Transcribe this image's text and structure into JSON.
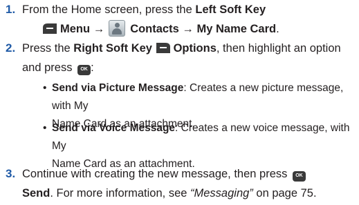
{
  "steps": [
    {
      "num": "1.",
      "line1": "From the Home screen, press the ",
      "line1_b": "Left Soft Key",
      "menu": "Menu",
      "arrow": "→",
      "contacts": "Contacts",
      "my_name_card": "My Name Card",
      "period": "."
    },
    {
      "num": "2.",
      "press": "Press the ",
      "right_soft_key": "Right Soft Key",
      "options": "Options",
      "rest1": ", then highlight an option",
      "line2": "and press",
      "colon": ":"
    },
    {
      "num": "3.",
      "line1": "Continue with creating the new message, then press",
      "send": "Send",
      "mid": ". For more information, see ",
      "ref": "“Messaging”",
      "tail": " on page 75."
    }
  ],
  "bullets": [
    {
      "dot": "•",
      "label": "Send via Picture Message",
      "desc1": ": Creates a new picture message, with My",
      "desc2": "Name Card as an attachment."
    },
    {
      "dot": "•",
      "label": "Send via Voice Message",
      "desc1": ": Creates a new voice message, with My",
      "desc2": "Name Card as an attachment."
    }
  ],
  "icons": {
    "ok_label": "OK",
    "left_soft_key": "left-softkey-icon",
    "right_soft_key": "right-softkey-icon",
    "contacts": "contacts-icon",
    "ok": "ok-key-icon"
  },
  "colors": {
    "step_number": "#1f5aa6",
    "text": "#231f20",
    "icon_dark": "#3a3a3a"
  }
}
